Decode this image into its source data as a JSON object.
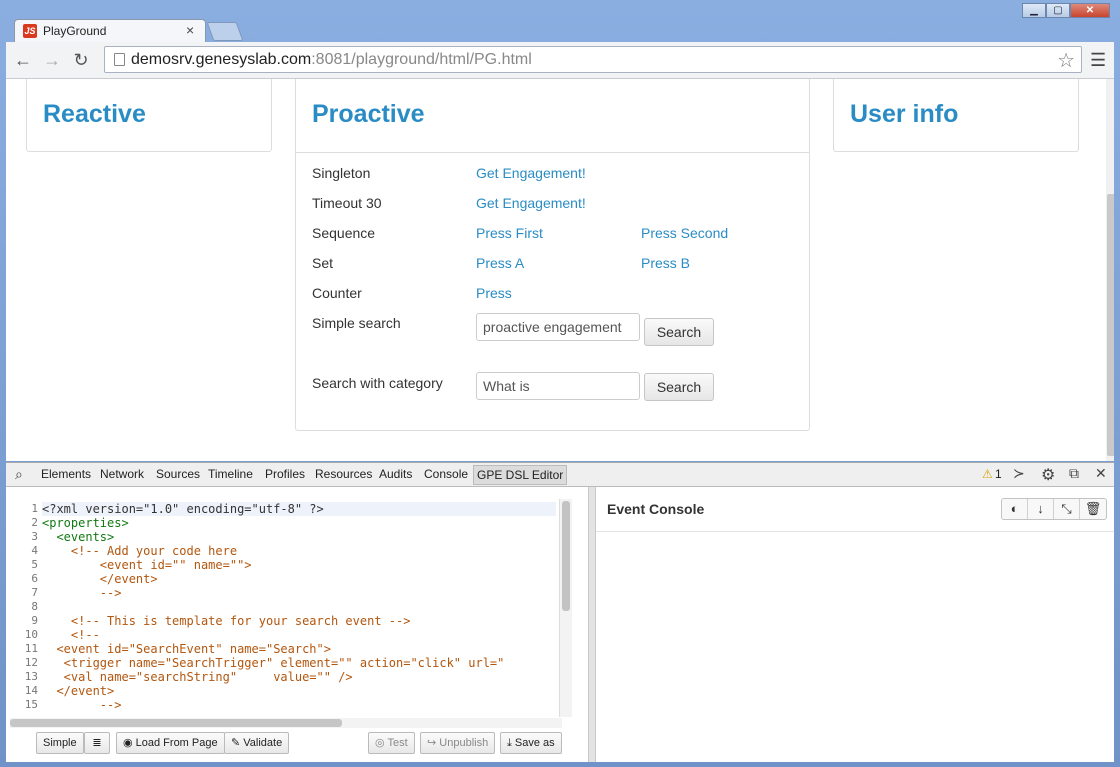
{
  "browser": {
    "tab_title": "PlayGround",
    "tab_close": "×",
    "favicon_letter": "JS",
    "url_host": "demosrv.genesyslab.com",
    "url_rest": ":8081/playground/html/PG.html",
    "window_controls": [
      "minimize",
      "maximize",
      "close"
    ]
  },
  "page": {
    "reactive_title": "Reactive",
    "proactive_title": "Proactive",
    "userinfo_title": "User info",
    "rows": [
      {
        "label": "Singleton",
        "link1": "Get Engagement!"
      },
      {
        "label": "Timeout 30",
        "link1": "Get Engagement!"
      },
      {
        "label": "Sequence",
        "link1": "Press First",
        "link2": "Press Second"
      },
      {
        "label": "Set",
        "link1": "Press A",
        "link2": "Press B"
      },
      {
        "label": "Counter",
        "link1": "Press"
      }
    ],
    "simple_search": {
      "label": "Simple search",
      "value": "proactive engagement",
      "button": "Search"
    },
    "category_search": {
      "label": "Search with category",
      "value": "What is",
      "button": "Search"
    }
  },
  "devtools": {
    "tabs": [
      "Elements",
      "Network",
      "Sources",
      "Timeline",
      "Profiles",
      "Resources",
      "Audits",
      "Console",
      "GPE DSL Editor"
    ],
    "active_tab": "GPE DSL Editor",
    "warning_count": "1",
    "editor_buttons": {
      "simple": "Simple",
      "load": "Load From Page",
      "validate": "Validate",
      "test": "Test",
      "unpublish": "Unpublish",
      "save_as": "Save as"
    },
    "console_title": "Event Console",
    "line_numbers": [
      "1",
      "2",
      "3",
      "4",
      "5",
      "6",
      "7",
      "8",
      "9",
      "10",
      "11",
      "12",
      "13",
      "14",
      "15"
    ]
  },
  "icons": {
    "back": "arrow-left-icon",
    "forward": "arrow-right-icon",
    "reload": "reload-icon",
    "star": "star-icon",
    "menu": "hamburger-menu-icon"
  },
  "colors": {
    "link": "#2a8cc5",
    "xml_tag": "#117a11",
    "xml_comment": "#b3560e"
  }
}
